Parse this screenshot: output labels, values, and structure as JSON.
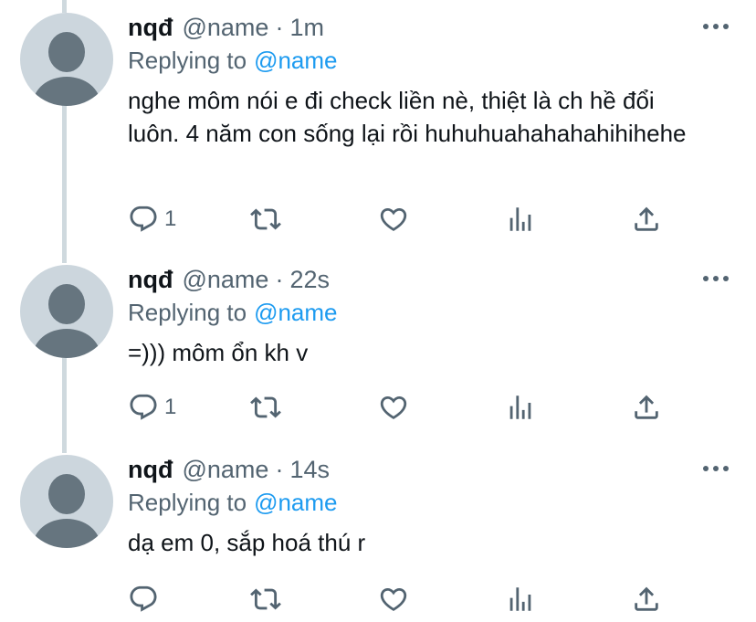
{
  "icon_color": "#536471",
  "accent_color": "#1d9bf0",
  "tweets": [
    {
      "display_name": "nqđ",
      "handle": "@name",
      "separator": "·",
      "time": "1m",
      "replying_label": "Replying to",
      "replying_to": "@name",
      "text": "nghe môm nói e đi check liền nè, thiệt là ch hề đổi luôn. 4 năm con sống lại rồi huhuhuahahahahihihehe",
      "reply_count": "1",
      "icons": [
        "reply-icon",
        "retweet-icon",
        "like-icon",
        "analytics-icon",
        "share-icon"
      ]
    },
    {
      "display_name": "nqđ",
      "handle": "@name",
      "separator": "·",
      "time": "22s",
      "replying_label": "Replying to",
      "replying_to": "@name",
      "text": "=))) môm ổn kh v",
      "reply_count": "1",
      "icons": [
        "reply-icon",
        "retweet-icon",
        "like-icon",
        "analytics-icon",
        "share-icon"
      ]
    },
    {
      "display_name": "nqđ",
      "handle": "@name",
      "separator": "·",
      "time": "14s",
      "replying_label": "Replying to",
      "replying_to": "@name",
      "text": "dạ em 0, sắp hoá thú r",
      "reply_count": "",
      "icons": [
        "reply-icon",
        "retweet-icon",
        "like-icon",
        "analytics-icon",
        "share-icon"
      ]
    }
  ]
}
